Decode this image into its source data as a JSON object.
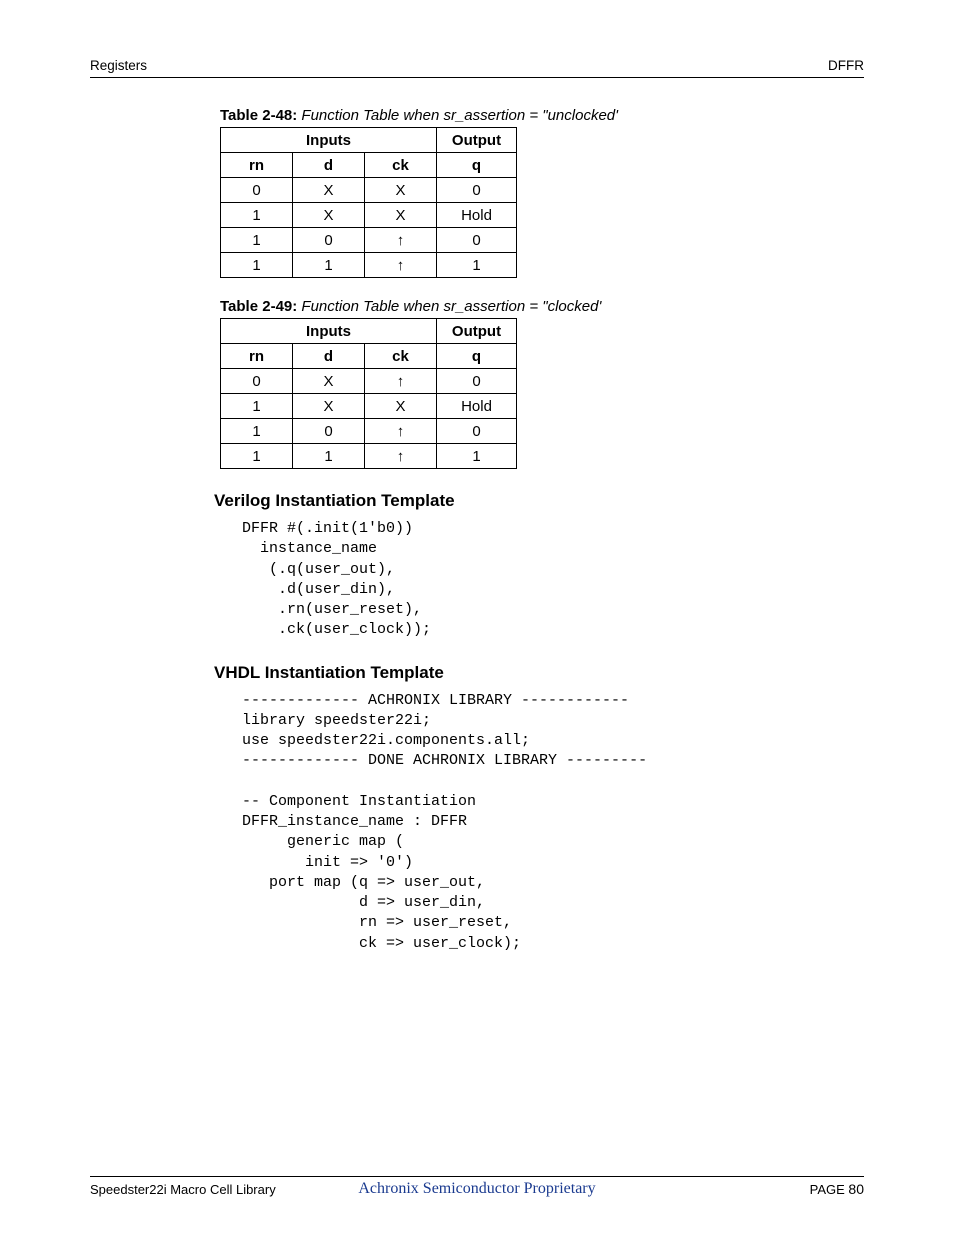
{
  "header": {
    "left": "Registers",
    "right": "DFFR"
  },
  "tables": [
    {
      "caption_label": "Table 2-48:",
      "caption_text": "Function Table when sr_assertion = \"unclocked'",
      "inputs_header": "Inputs",
      "output_header": "Output",
      "cols": [
        "rn",
        "d",
        "ck",
        "q"
      ],
      "rows": [
        [
          "0",
          "X",
          "X",
          "0"
        ],
        [
          "1",
          "X",
          "X",
          "Hold"
        ],
        [
          "1",
          "0",
          "↑",
          "0"
        ],
        [
          "1",
          "1",
          "↑",
          "1"
        ]
      ]
    },
    {
      "caption_label": "Table 2-49:",
      "caption_text": "Function Table when sr_assertion = \"clocked'",
      "inputs_header": "Inputs",
      "output_header": "Output",
      "cols": [
        "rn",
        "d",
        "ck",
        "q"
      ],
      "rows": [
        [
          "0",
          "X",
          "↑",
          "0"
        ],
        [
          "1",
          "X",
          "X",
          "Hold"
        ],
        [
          "1",
          "0",
          "↑",
          "0"
        ],
        [
          "1",
          "1",
          "↑",
          "1"
        ]
      ]
    }
  ],
  "sections": {
    "verilog_heading": "Verilog Instantiation Template",
    "verilog_code": "DFFR #(.init(1'b0))\n  instance_name\n   (.q(user_out),\n    .d(user_din),\n    .rn(user_reset),\n    .ck(user_clock));",
    "vhdl_heading": "VHDL Instantiation Template",
    "vhdl_code": "------------- ACHRONIX LIBRARY ------------\nlibrary speedster22i;\nuse speedster22i.components.all;\n------------- DONE ACHRONIX LIBRARY ---------\n\n-- Component Instantiation\nDFFR_instance_name : DFFR\n     generic map (\n       init => '0')\n   port map (q => user_out,\n             d => user_din,\n             rn => user_reset,\n             ck => user_clock);"
  },
  "footer": {
    "left": "Speedster22i Macro Cell Library",
    "center": "Achronix Semiconductor Proprietary",
    "right_label": "PAGE",
    "right_value": "80"
  }
}
